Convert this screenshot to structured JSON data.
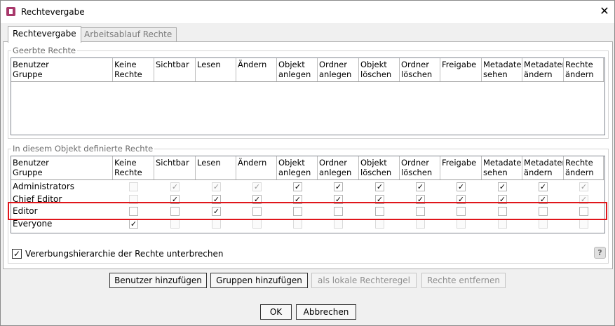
{
  "window": {
    "title": "Rechtevergabe",
    "close_glyph": "✕"
  },
  "tabs": [
    {
      "label": "Rechtevergabe",
      "active": true
    },
    {
      "label": "Arbeitsablauf Rechte",
      "active": false
    }
  ],
  "inherited": {
    "legend": "Geerbte Rechte",
    "columns": [
      "Benutzer\nGruppe",
      "Keine\nRechte",
      "Sichtbar",
      "Lesen",
      "Ändern",
      "Objekt\nanlegen",
      "Ordner\nanlegen",
      "Objekt\nlöschen",
      "Ordner\nlöschen",
      "Freigabe",
      "Metadaten\nsehen",
      "Metadaten\nändern",
      "Rechte\nändern"
    ],
    "rows": []
  },
  "defined": {
    "legend": "In diesem Objekt definierte Rechte",
    "columns": [
      "Benutzer\nGruppe",
      "Keine\nRechte",
      "Sichtbar",
      "Lesen",
      "Ändern",
      "Objekt\nanlegen",
      "Ordner\nanlegen",
      "Objekt\nlöschen",
      "Ordner\nlöschen",
      "Freigabe",
      "Metadaten\nsehen",
      "Metadaten\nändern",
      "Rechte\nändern"
    ],
    "rows": [
      {
        "name": "Administrators",
        "cells": [
          "disabled",
          "disabled-checked",
          "disabled-checked",
          "disabled-checked",
          "checked",
          "checked",
          "checked",
          "checked",
          "checked",
          "checked",
          "checked",
          "disabled-checked"
        ]
      },
      {
        "name": "Chief Editor",
        "cells": [
          "disabled",
          "checked",
          "checked",
          "checked",
          "checked",
          "checked",
          "checked",
          "checked",
          "checked",
          "checked",
          "checked",
          "disabled-checked"
        ]
      },
      {
        "name": "Editor",
        "cells": [
          "unchecked",
          "unchecked",
          "checked",
          "unchecked",
          "unchecked",
          "unchecked",
          "unchecked",
          "unchecked",
          "unchecked",
          "unchecked",
          "unchecked",
          "unchecked"
        ],
        "highlighted": true
      },
      {
        "name": "Everyone",
        "cells": [
          "checked",
          "disabled",
          "disabled",
          "disabled",
          "disabled",
          "disabled",
          "disabled",
          "disabled",
          "disabled",
          "disabled",
          "disabled",
          "disabled"
        ]
      }
    ]
  },
  "inheritance_checkbox": {
    "label": "Vererbungshierarchie der Rechte unterbrechen",
    "checked": true
  },
  "help_icon": "?",
  "action_buttons": [
    {
      "label": "Benutzer hinzufügen",
      "enabled": true
    },
    {
      "label": "Gruppen hinzufügen",
      "enabled": true
    },
    {
      "label": "als lokale Rechteregel",
      "enabled": false
    },
    {
      "label": "Rechte entfernen",
      "enabled": false
    }
  ],
  "dialog_buttons": {
    "ok": "OK",
    "cancel": "Abbrechen"
  },
  "colors": {
    "highlight": "#e0161b",
    "app_icon": "#a8386b"
  }
}
